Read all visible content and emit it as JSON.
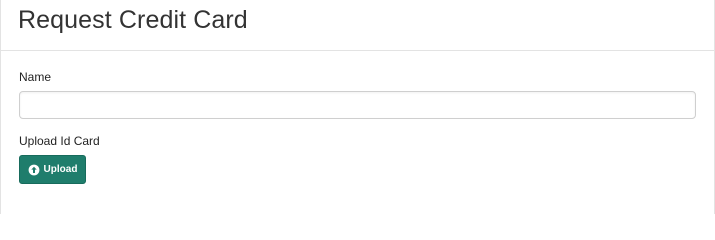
{
  "header": {
    "title": "Request Credit Card"
  },
  "form": {
    "name_label": "Name",
    "name_value": "",
    "upload_label": "Upload Id Card",
    "upload_button_label": "Upload",
    "upload_icon": "arrow-up-circle-icon"
  },
  "colors": {
    "upload_button_bg": "#1f7d6c",
    "border": "#e3e3e3"
  }
}
